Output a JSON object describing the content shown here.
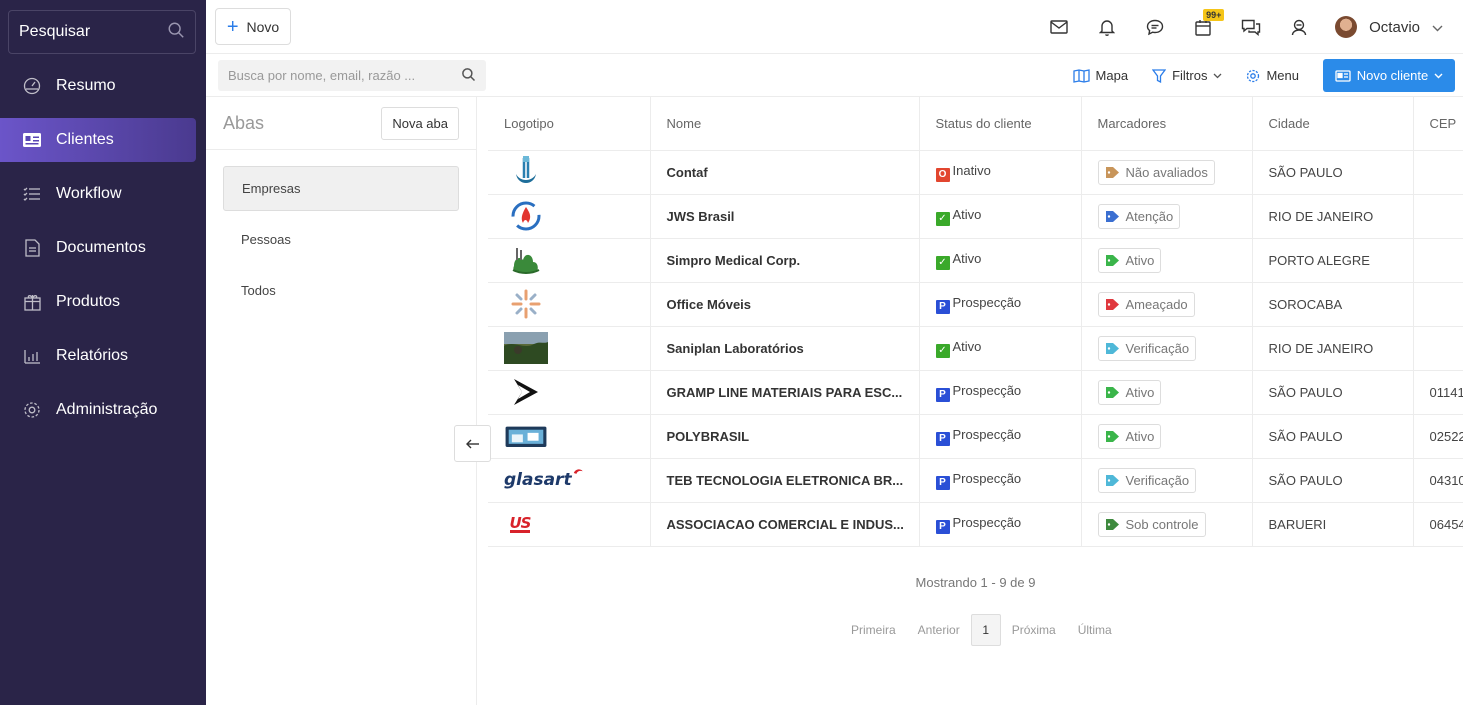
{
  "sidebar": {
    "search_label": "Pesquisar",
    "items": [
      {
        "label": "Resumo",
        "icon": "dashboard-icon"
      },
      {
        "label": "Clientes",
        "icon": "id-card-icon",
        "active": true
      },
      {
        "label": "Workflow",
        "icon": "list-icon"
      },
      {
        "label": "Documentos",
        "icon": "document-icon"
      },
      {
        "label": "Produtos",
        "icon": "box-icon"
      },
      {
        "label": "Relatórios",
        "icon": "bar-chart-icon"
      },
      {
        "label": "Administração",
        "icon": "gear-icon"
      }
    ]
  },
  "topbar": {
    "new_label": "Novo",
    "badge": "99+",
    "user_name": "Octavio"
  },
  "subbar": {
    "search_placeholder": "Busca por nome, email, razão ...",
    "map_label": "Mapa",
    "filters_label": "Filtros",
    "menu_label": "Menu",
    "new_client_label": "Novo cliente"
  },
  "abas": {
    "title": "Abas",
    "new_tab_label": "Nova aba",
    "items": [
      "Empresas",
      "Pessoas",
      "Todos"
    ]
  },
  "table": {
    "headers": [
      "Logotipo",
      "Nome",
      "Status do cliente",
      "Marcadores",
      "Cidade",
      "CEP"
    ],
    "rows": [
      {
        "nome": "Contaf",
        "status": "Inativo",
        "marcador": "Não avaliados",
        "cidade": "SÃO PAULO",
        "cep": ""
      },
      {
        "nome": "JWS Brasil",
        "status": "Ativo",
        "marcador": "Atenção",
        "cidade": "RIO DE JANEIRO",
        "cep": ""
      },
      {
        "nome": "Simpro Medical Corp.",
        "status": "Ativo",
        "marcador": "Ativo",
        "cidade": "PORTO ALEGRE",
        "cep": ""
      },
      {
        "nome": "Office Móveis",
        "status": "Prospecção",
        "marcador": "Ameaçado",
        "cidade": "SOROCABA",
        "cep": ""
      },
      {
        "nome": "Saniplan Laboratórios",
        "status": "Ativo",
        "marcador": "Verificação",
        "cidade": "RIO DE JANEIRO",
        "cep": ""
      },
      {
        "nome": "GRAMP LINE MATERIAIS PARA ESC...",
        "status": "Prospecção",
        "marcador": "Ativo",
        "cidade": "SÃO PAULO",
        "cep": "01141"
      },
      {
        "nome": "POLYBRASIL",
        "status": "Prospecção",
        "marcador": "Ativo",
        "cidade": "SÃO PAULO",
        "cep": "02522"
      },
      {
        "nome": "TEB TECNOLOGIA ELETRONICA BR...",
        "status": "Prospecção",
        "marcador": "Verificação",
        "cidade": "SÃO PAULO",
        "cep": "04310"
      },
      {
        "nome": "ASSOCIACAO COMERCIAL E INDUS...",
        "status": "Prospecção",
        "marcador": "Sob controle",
        "cidade": "BARUERI",
        "cep": "06454"
      }
    ],
    "logo_text": {
      "glasart": "glasart",
      "us": "US"
    }
  },
  "status_styles": {
    "Inativo": {
      "glyph": "O",
      "color": "#e2462f"
    },
    "Ativo": {
      "glyph": "✓",
      "color": "#3aa92a"
    },
    "Prospecção": {
      "glyph": "P",
      "color": "#2a4fd6"
    }
  },
  "tag_colors": {
    "Não avaliados": "#c8955a",
    "Atenção": "#3b6fd1",
    "Ativo": "#3ab54a",
    "Ameaçado": "#e0383e",
    "Verificação": "#4fb8d8",
    "Sob controle": "#3e8a3e"
  },
  "footer": {
    "showing": "Mostrando 1 - 9 de 9",
    "first": "Primeira",
    "prev": "Anterior",
    "page": "1",
    "next": "Próxima",
    "last": "Última"
  }
}
